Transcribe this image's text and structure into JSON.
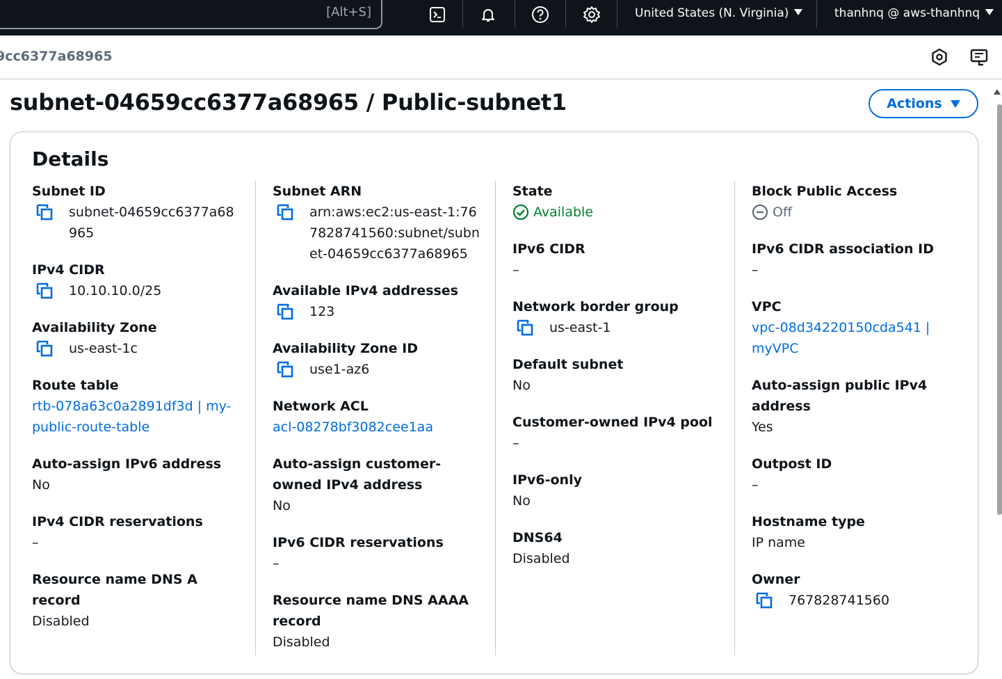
{
  "topnav": {
    "search_shortcut": "[Alt+S]",
    "region": "United States (N. Virginia)",
    "account": "thanhnq @ aws-thanhnq"
  },
  "breadcrumb": {
    "current": "9cc6377a68965"
  },
  "page": {
    "title": "subnet-04659cc6377a68965 / Public-subnet1",
    "actions_label": "Actions"
  },
  "details": {
    "title": "Details",
    "col1": {
      "subnet_id": {
        "label": "Subnet ID",
        "value": "subnet-04659cc6377a68965"
      },
      "ipv4_cidr": {
        "label": "IPv4 CIDR",
        "value": "10.10.10.0/25"
      },
      "az": {
        "label": "Availability Zone",
        "value": "us-east-1c"
      },
      "route_table": {
        "label": "Route table",
        "value": "rtb-078a63c0a2891df3d | my-public-route-table"
      },
      "auto_ipv6": {
        "label": "Auto-assign IPv6 address",
        "value": "No"
      },
      "ipv4_reservations": {
        "label": "IPv4 CIDR reservations",
        "value": "–"
      },
      "dns_a": {
        "label": "Resource name DNS A record",
        "value": "Disabled"
      }
    },
    "col2": {
      "subnet_arn": {
        "label": "Subnet ARN",
        "value": "arn:aws:ec2:us-east-1:767828741560:subnet/subnet-04659cc6377a68965"
      },
      "available_ipv4": {
        "label": "Available IPv4 addresses",
        "value": "123"
      },
      "az_id": {
        "label": "Availability Zone ID",
        "value": "use1-az6"
      },
      "nacl": {
        "label": "Network ACL",
        "value": "acl-08278bf3082cee1aa"
      },
      "auto_customer_ipv4": {
        "label": "Auto-assign customer-owned IPv4 address",
        "value": "No"
      },
      "ipv6_reservations": {
        "label": "IPv6 CIDR reservations",
        "value": "–"
      },
      "dns_aaaa": {
        "label": "Resource name DNS AAAA record",
        "value": "Disabled"
      }
    },
    "col3": {
      "state": {
        "label": "State",
        "value": "Available"
      },
      "ipv6_cidr": {
        "label": "IPv6 CIDR",
        "value": "–"
      },
      "border_group": {
        "label": "Network border group",
        "value": "us-east-1"
      },
      "default_subnet": {
        "label": "Default subnet",
        "value": "No"
      },
      "customer_pool": {
        "label": "Customer-owned IPv4 pool",
        "value": "–"
      },
      "ipv6_only": {
        "label": "IPv6-only",
        "value": "No"
      },
      "dns64": {
        "label": "DNS64",
        "value": "Disabled"
      }
    },
    "col4": {
      "block_public": {
        "label": "Block Public Access",
        "value": "Off"
      },
      "ipv6_assoc": {
        "label": "IPv6 CIDR association ID",
        "value": "–"
      },
      "vpc": {
        "label": "VPC",
        "value": "vpc-08d34220150cda541 | myVPC"
      },
      "auto_public_ipv4": {
        "label": "Auto-assign public IPv4 address",
        "value": "Yes"
      },
      "outpost": {
        "label": "Outpost ID",
        "value": "–"
      },
      "hostname_type": {
        "label": "Hostname type",
        "value": "IP name"
      },
      "owner": {
        "label": "Owner",
        "value": "767828741560"
      }
    }
  },
  "colors": {
    "nav_bg": "#0f141a",
    "link": "#006ce0",
    "success": "#00802f",
    "muted": "#5f6b7a"
  }
}
